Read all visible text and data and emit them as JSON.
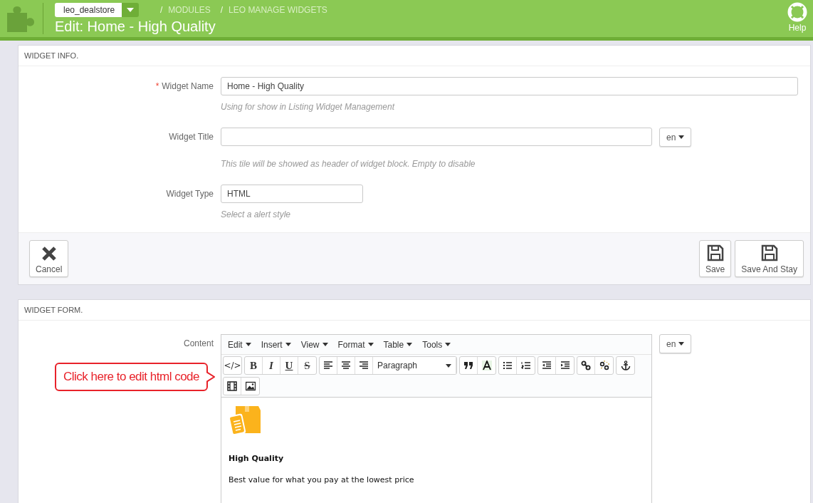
{
  "header": {
    "shop": "leo_dealstore",
    "breadcrumb": [
      {
        "separator": "/",
        "label": "MODULES"
      },
      {
        "separator": "/",
        "label": "LEO MANAGE WIDGETS"
      }
    ],
    "title": "Edit: Home - High Quality",
    "help": "Help"
  },
  "widget_info": {
    "heading": "WIDGET INFO.",
    "fields": [
      {
        "kind": "text",
        "label": "Widget Name",
        "required": true,
        "value": "Home - High Quality",
        "hint": "Using for show in Listing Widget Management"
      },
      {
        "kind": "lang",
        "label": "Widget Title",
        "required": false,
        "lang": "en",
        "hint": "This tile will be showed as header of widget block. Empty to disable"
      },
      {
        "kind": "short",
        "label": "Widget Type",
        "required": false,
        "value": "HTML",
        "hint": "Select a alert style"
      }
    ],
    "required_mark": "*",
    "cancel": "Cancel",
    "save": "Save",
    "save_and_stay": "Save And Stay"
  },
  "widget_form": {
    "heading": "WIDGET FORM.",
    "label": "Content",
    "lang": "en",
    "callout": "Click here to edit html code",
    "menus": [
      "Edit",
      "Insert",
      "View",
      "Format",
      "Table",
      "Tools"
    ],
    "code_button": "</>",
    "format_buttons": [
      "B",
      "I",
      "U",
      "S"
    ],
    "block_format": "Paragraph",
    "content_title": "High Quality",
    "content_text": "Best value for what you pay at the lowest price"
  }
}
